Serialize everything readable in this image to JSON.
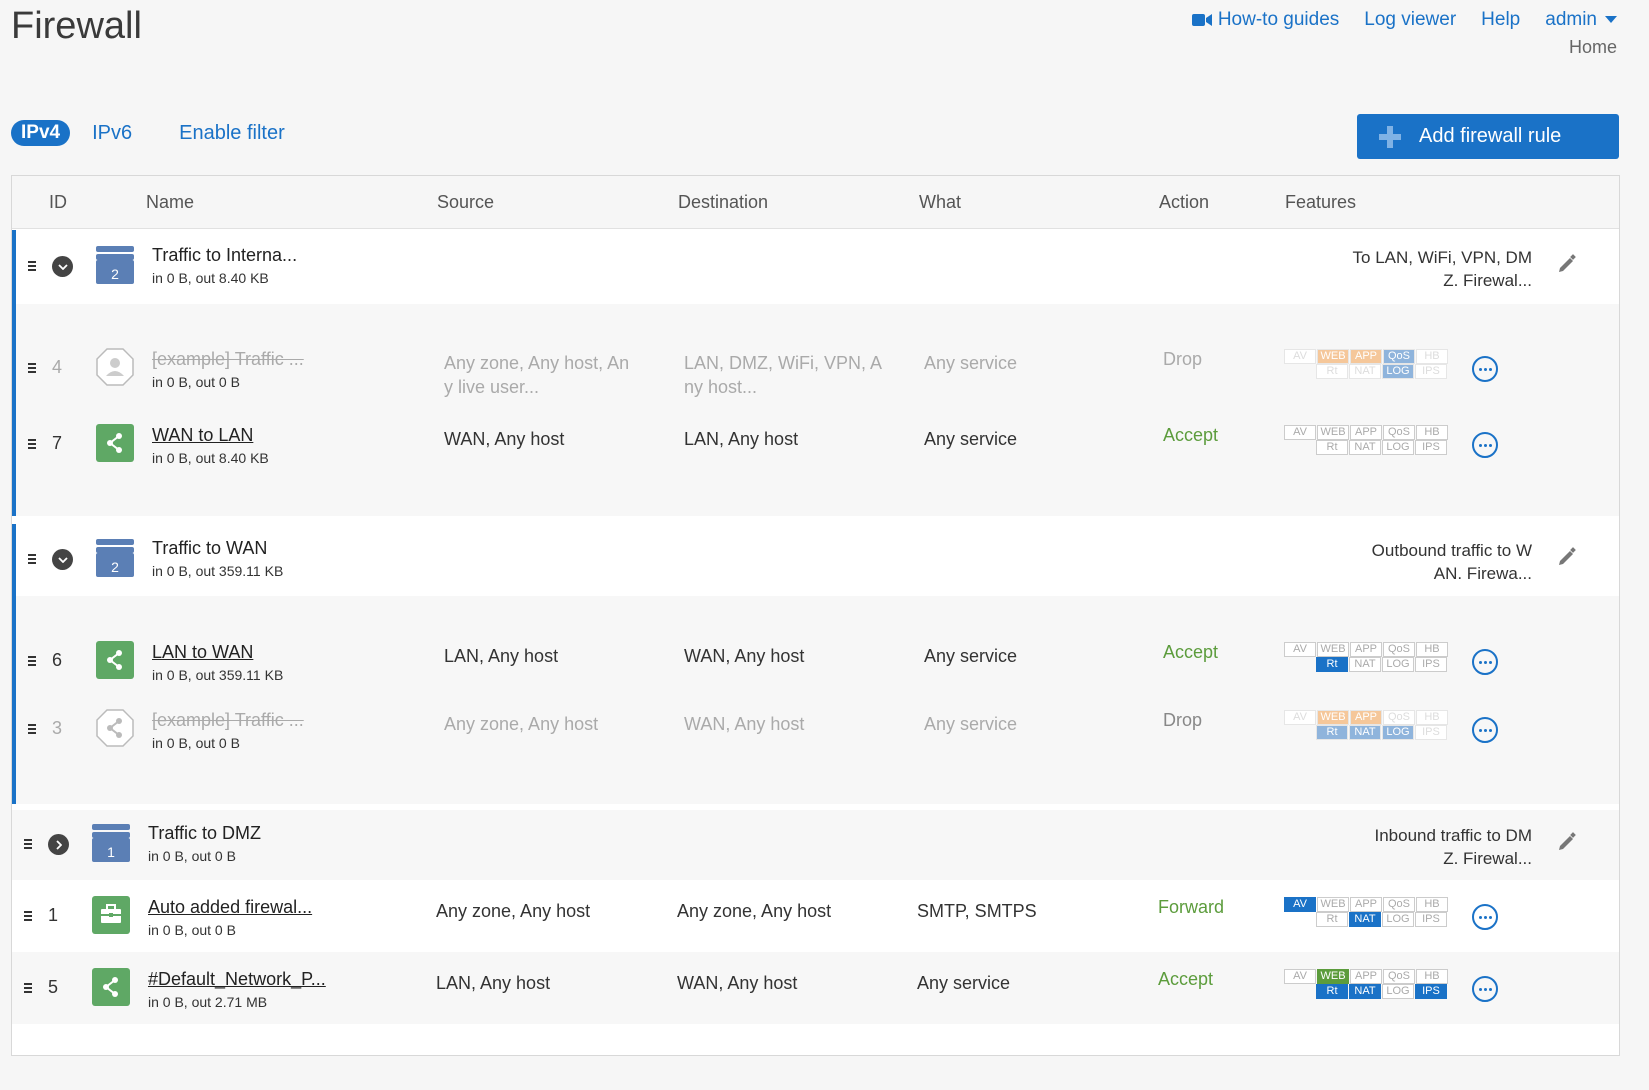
{
  "page": {
    "title": "Firewall",
    "breadcrumb": "Home"
  },
  "top_links": {
    "guides": "How-to guides",
    "log_viewer": "Log viewer",
    "help": "Help",
    "user": "admin"
  },
  "toolbar": {
    "ipv4": "IPv4",
    "ipv6": "IPv6",
    "filter": "Enable filter",
    "add_rule": "Add firewall rule"
  },
  "columns": {
    "id": "ID",
    "name": "Name",
    "source": "Source",
    "destination": "Destination",
    "what": "What",
    "action": "Action",
    "features": "Features"
  },
  "groups": [
    {
      "count": "2",
      "name": "Traffic to Interna...",
      "stats": "in 0 B, out 8.40 KB",
      "desc1": "To LAN, WiFi, VPN, DM",
      "desc2": "Z. Firewal..."
    },
    {
      "count": "2",
      "name": "Traffic to WAN",
      "stats": "in 0 B, out 359.11 KB",
      "desc1": "Outbound traffic to W",
      "desc2": "AN. Firewa..."
    },
    {
      "count": "1",
      "name": "Traffic to DMZ",
      "stats": "in 0 B, out 0 B",
      "desc1": "Inbound traffic to DM",
      "desc2": "Z. Firewal..."
    }
  ],
  "rules": [
    {
      "id": "4",
      "name": "[example] Traffic ...",
      "stats": "in 0 B, out 0 B",
      "source1": "Any zone, Any host, An",
      "source2": "y live user...",
      "dest1": "LAN, DMZ, WiFi, VPN, A",
      "dest2": "ny host...",
      "what": "Any service",
      "action": "Drop"
    },
    {
      "id": "7",
      "name": "WAN to LAN",
      "stats": "in 0 B, out 8.40 KB",
      "source1": "WAN, Any host",
      "dest1": "LAN, Any host",
      "what": "Any service",
      "action": "Accept"
    },
    {
      "id": "6",
      "name": "LAN to WAN",
      "stats": "in 0 B, out 359.11 KB",
      "source1": "LAN, Any host",
      "dest1": "WAN, Any host",
      "what": "Any service",
      "action": "Accept"
    },
    {
      "id": "3",
      "name": "[example] Traffic ...",
      "stats": "in 0 B, out 0 B",
      "source1": "Any zone, Any host",
      "dest1": "WAN, Any host",
      "what": "Any service",
      "action": "Drop"
    },
    {
      "id": "1",
      "name": "Auto added firewal...",
      "stats": "in 0 B, out 0 B",
      "source1": "Any zone, Any host",
      "dest1": "Any zone, Any host",
      "what": "SMTP, SMTPS",
      "action": "Forward"
    },
    {
      "id": "5",
      "name": "#Default_Network_P...",
      "stats": "in 0 B, out 2.71 MB",
      "source1": "LAN, Any host",
      "dest1": "WAN, Any host",
      "what": "Any service",
      "action": "Accept"
    }
  ],
  "feature_labels": {
    "av": "AV",
    "web": "WEB",
    "app": "APP",
    "qos": "QoS",
    "hb": "HB",
    "rt": "Rt",
    "nat": "NAT",
    "log": "LOG",
    "ips": "IPS"
  },
  "colors": {
    "accent": "#1a72c7",
    "accept": "#5c9c3c",
    "group_icon": "#5b7fb5",
    "rule_icon": "#5fa865"
  }
}
